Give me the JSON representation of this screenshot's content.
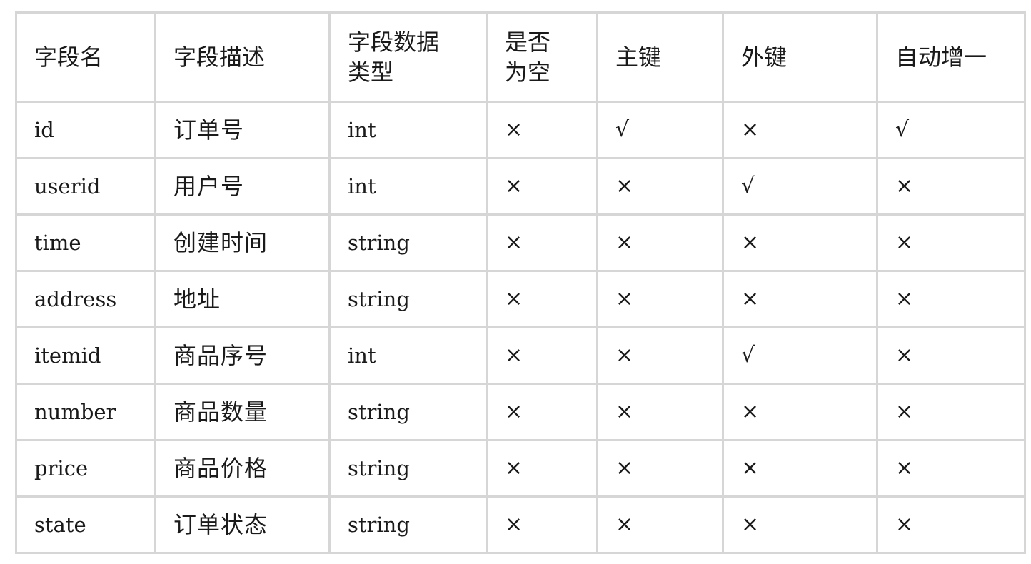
{
  "table": {
    "headers": [
      "字段名",
      "字段描述",
      "字段数据类型",
      "是否为空",
      "主键",
      "外键",
      "自动增一"
    ],
    "rows": [
      {
        "name": "id",
        "desc": "订单号",
        "type": "int",
        "nullable": "×",
        "pk": "√",
        "fk": "×",
        "auto": "√"
      },
      {
        "name": "userid",
        "desc": "用户号",
        "type": "int",
        "nullable": "×",
        "pk": "×",
        "fk": "√",
        "auto": "×"
      },
      {
        "name": "time",
        "desc": "创建时间",
        "type": "string",
        "nullable": "×",
        "pk": "×",
        "fk": "×",
        "auto": "×"
      },
      {
        "name": "address",
        "desc": "地址",
        "type": "string",
        "nullable": "×",
        "pk": "×",
        "fk": "×",
        "auto": "×"
      },
      {
        "name": "itemid",
        "desc": "商品序号",
        "type": "int",
        "nullable": "×",
        "pk": "×",
        "fk": "√",
        "auto": "×"
      },
      {
        "name": "number",
        "desc": "商品数量",
        "type": "string",
        "nullable": "×",
        "pk": "×",
        "fk": "×",
        "auto": "×"
      },
      {
        "name": "price",
        "desc": "商品价格",
        "type": "string",
        "nullable": "×",
        "pk": "×",
        "fk": "×",
        "auto": "×"
      },
      {
        "name": "state",
        "desc": "订单状态",
        "type": "string",
        "nullable": "×",
        "pk": "×",
        "fk": "×",
        "auto": "×"
      }
    ]
  }
}
